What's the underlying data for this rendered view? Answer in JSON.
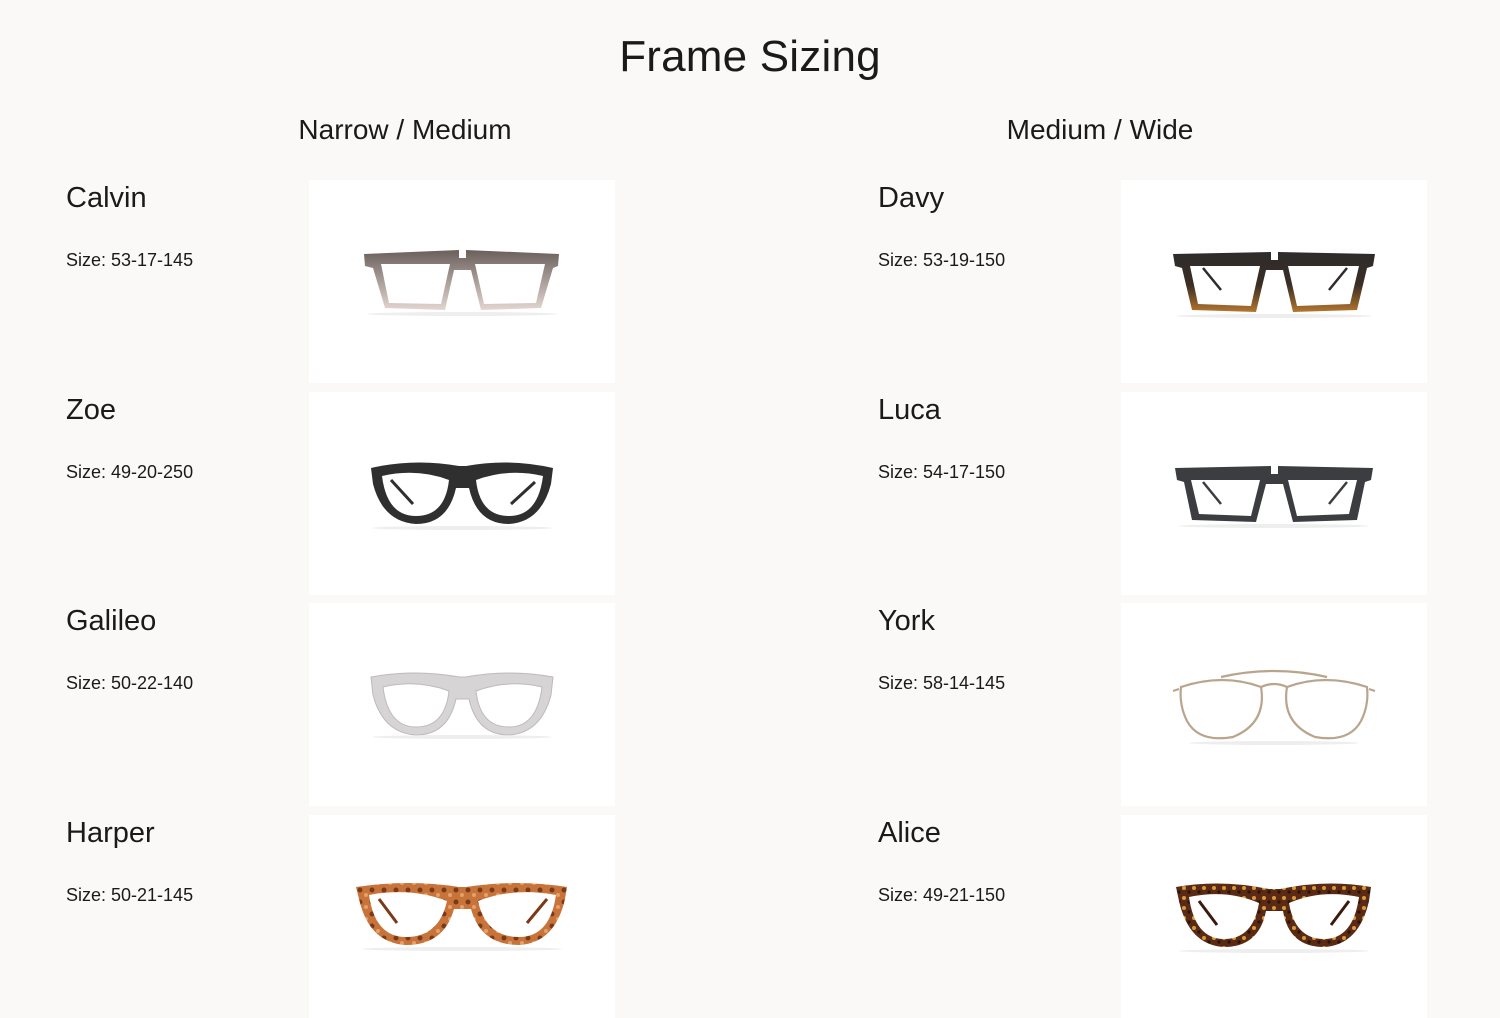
{
  "page": {
    "title": "Frame Sizing"
  },
  "columns": [
    {
      "heading": "Narrow / Medium",
      "frames": [
        {
          "name": "Calvin",
          "size": "Size: 53-17-145",
          "image": "rectangular-glasses-brown-fade"
        },
        {
          "name": "Zoe",
          "size": "Size: 49-20-250",
          "image": "round-glasses-black"
        },
        {
          "name": "Galileo",
          "size": "Size: 50-22-140",
          "image": "round-glasses-clear"
        },
        {
          "name": "Harper",
          "size": "Size: 50-21-145",
          "image": "round-glasses-tortoise"
        }
      ]
    },
    {
      "heading": "Medium / Wide",
      "frames": [
        {
          "name": "Davy",
          "size": "Size: 53-19-150",
          "image": "rectangular-glasses-dark-tortoise"
        },
        {
          "name": "Luca",
          "size": "Size: 54-17-150",
          "image": "rectangular-glasses-grey"
        },
        {
          "name": "York",
          "size": "Size: 58-14-145",
          "image": "aviator-glasses-gold"
        },
        {
          "name": "Alice",
          "size": "Size: 49-21-150",
          "image": "round-glasses-dark-tortoise"
        }
      ]
    }
  ],
  "colors": {
    "background": "#faf9f7",
    "card": "#ffffff",
    "text": "#1a1a1a"
  }
}
